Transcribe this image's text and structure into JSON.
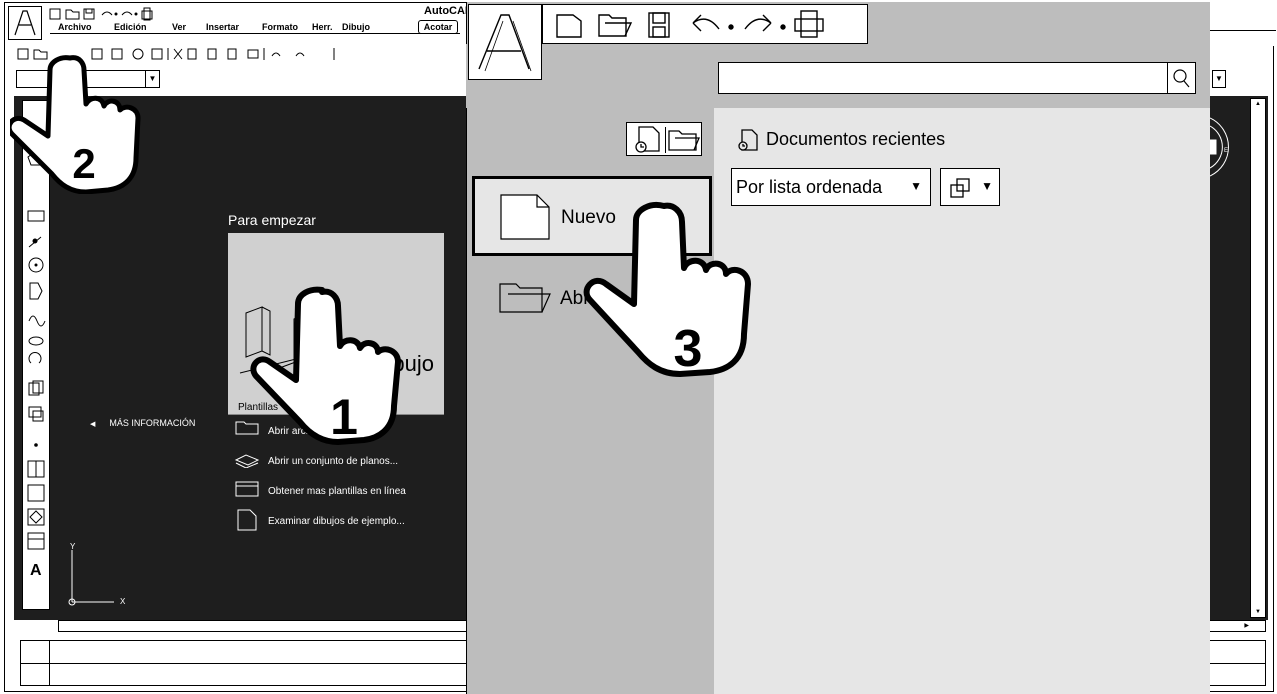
{
  "app": {
    "title": "AutoCAD"
  },
  "menu": {
    "items": [
      "Archivo",
      "Edición",
      "Ver",
      "Insertar",
      "Formato",
      "Herr.",
      "Dibujo"
    ],
    "acotar": "Acotar"
  },
  "start_page": {
    "heading": "Para empezar",
    "card_label": "Iniciar dibujo",
    "card_sub": "Plantillas",
    "more_info": "MÁS INFORMACIÓN",
    "links": [
      "Abrir archivos...",
      "Abrir un conjunto de planos...",
      "Obtener mas plantillas en línea",
      "Examinar dibujos de ejemplo..."
    ]
  },
  "axes": {
    "y": "Y",
    "x": "X"
  },
  "side_toolbar": {
    "text_tool": "A"
  },
  "app_menu": {
    "search": {
      "placeholder": "",
      "value": ""
    },
    "new_label": "Nuevo",
    "open_label": "Abrir",
    "recent_title": "Documentos recientes",
    "sort_value": "Por lista ordenada"
  },
  "steps": [
    "1",
    "2",
    "3"
  ],
  "icons": {
    "qat": [
      "new-icon",
      "open-icon",
      "save-icon",
      "undo-icon",
      "redo-icon",
      "plot-icon"
    ],
    "search": "search-icon",
    "recent": "recent-documents-icon",
    "view": "view-mode-icon"
  }
}
